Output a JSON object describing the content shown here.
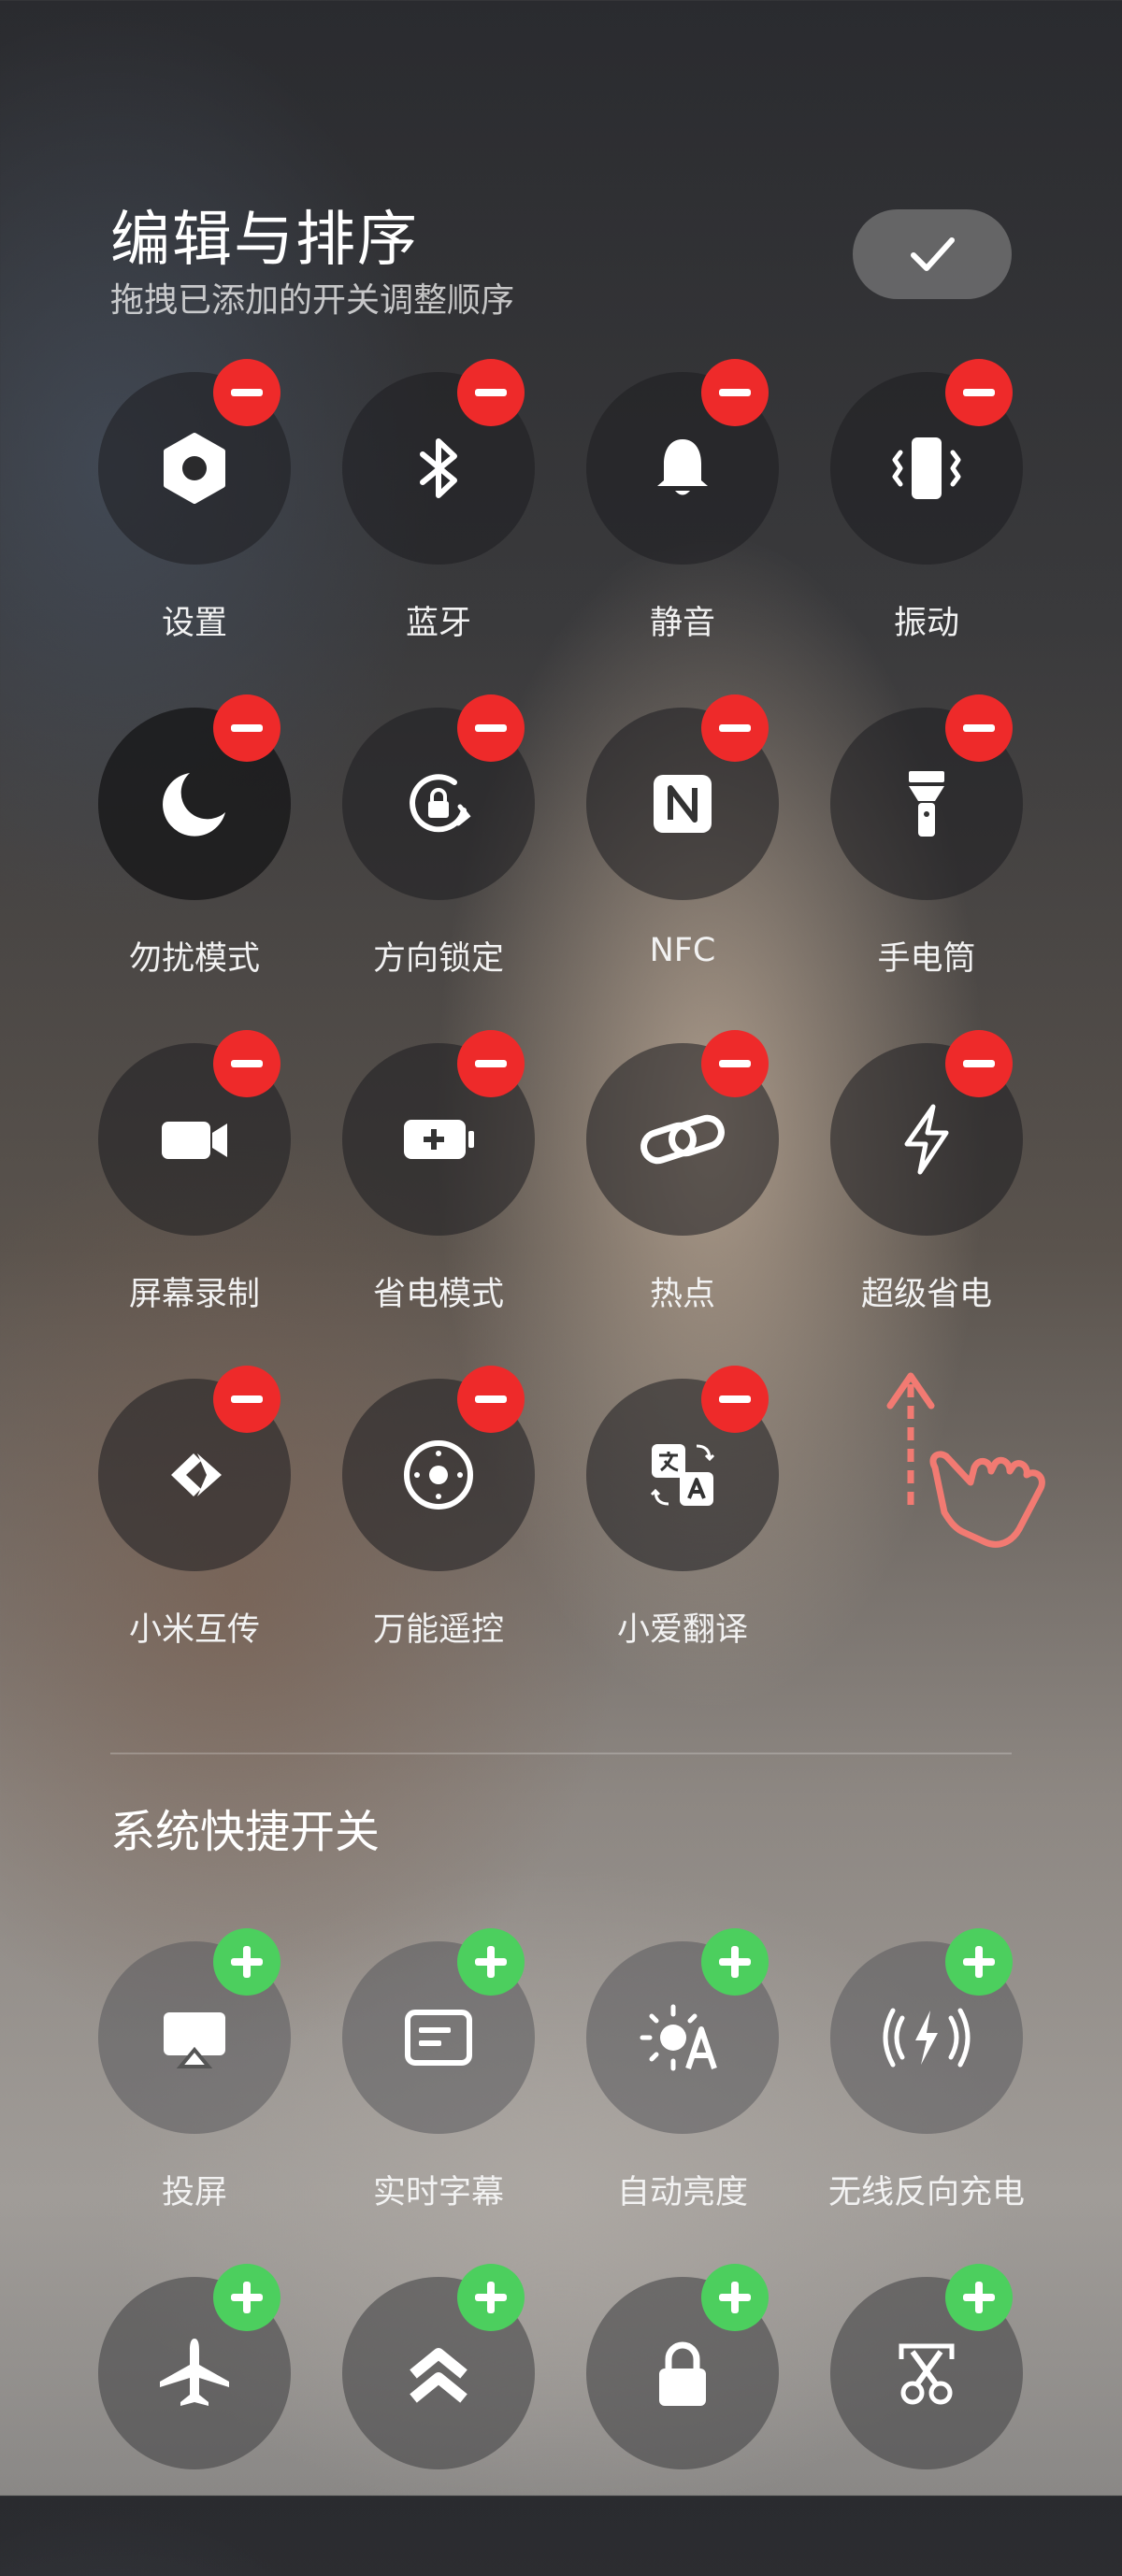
{
  "header": {
    "title": "编辑与排序",
    "subtitle": "拖拽已添加的开关调整顺序",
    "done_icon": "check-icon"
  },
  "added_toggles": [
    {
      "label": "设置",
      "icon": "settings-icon"
    },
    {
      "label": "蓝牙",
      "icon": "bluetooth-icon"
    },
    {
      "label": "静音",
      "icon": "bell-icon"
    },
    {
      "label": "振动",
      "icon": "vibrate-icon"
    },
    {
      "label": "勿扰模式",
      "icon": "moon-icon"
    },
    {
      "label": "方向锁定",
      "icon": "rotation-lock-icon"
    },
    {
      "label": "NFC",
      "icon": "nfc-icon"
    },
    {
      "label": "手电筒",
      "icon": "flashlight-icon"
    },
    {
      "label": "屏幕录制",
      "icon": "video-camera-icon"
    },
    {
      "label": "省电模式",
      "icon": "battery-saver-icon"
    },
    {
      "label": "热点",
      "icon": "hotspot-link-icon"
    },
    {
      "label": "超级省电",
      "icon": "lightning-icon"
    },
    {
      "label": "小米互传",
      "icon": "share-arrows-icon"
    },
    {
      "label": "万能遥控",
      "icon": "remote-control-icon"
    },
    {
      "label": "小爱翻译",
      "icon": "translate-icon"
    }
  ],
  "system_section": {
    "title": "系统快捷开关",
    "toggles": [
      {
        "label": "投屏",
        "icon": "cast-screen-icon"
      },
      {
        "label": "实时字幕",
        "icon": "caption-icon"
      },
      {
        "label": "自动亮度",
        "icon": "auto-brightness-icon"
      },
      {
        "label": "无线反向充电",
        "icon": "reverse-charge-icon"
      },
      {
        "label": "",
        "icon": "airplane-icon"
      },
      {
        "label": "",
        "icon": "chevrons-up-icon"
      },
      {
        "label": "",
        "icon": "lock-icon"
      },
      {
        "label": "",
        "icon": "scissors-icon"
      }
    ]
  },
  "colors": {
    "remove_badge": "#ee2a2a",
    "add_badge": "#4ccf5e",
    "hint": "#f27a72"
  }
}
